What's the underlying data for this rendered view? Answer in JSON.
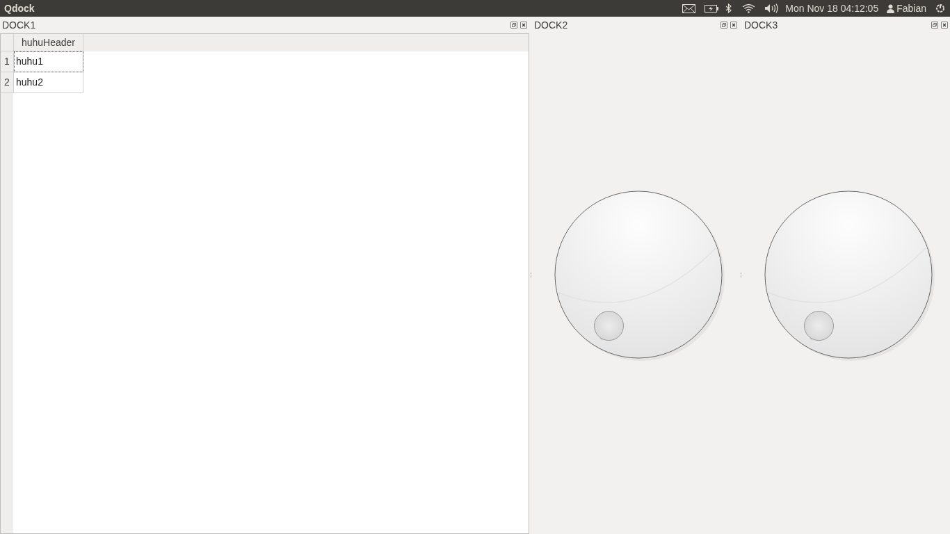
{
  "top_bar": {
    "title": "Qdock",
    "clock": "Mon Nov 18 04:12:05",
    "user": "Fabian"
  },
  "docks": [
    {
      "title": "DOCK1",
      "kind": "table",
      "table": {
        "columns": [
          "huhuHeader"
        ],
        "rows": [
          {
            "number": "1",
            "cells": [
              "huhu1"
            ],
            "focused": true
          },
          {
            "number": "2",
            "cells": [
              "huhu2"
            ],
            "focused": false
          }
        ]
      }
    },
    {
      "title": "DOCK2",
      "kind": "dial"
    },
    {
      "title": "DOCK3",
      "kind": "dial"
    }
  ]
}
